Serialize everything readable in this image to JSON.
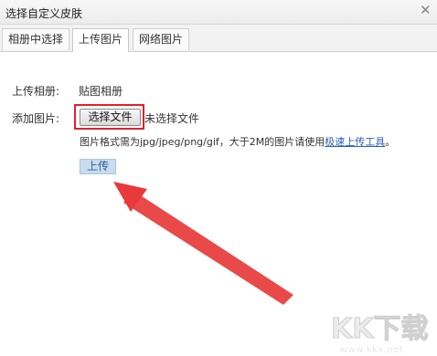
{
  "window": {
    "title": "选择自定义皮肤"
  },
  "tabs": [
    {
      "label": "相册中选择"
    },
    {
      "label": "上传图片"
    },
    {
      "label": "网络图片"
    }
  ],
  "form": {
    "album_label": "上传相册:",
    "album_value": "贴图相册",
    "add_label": "添加图片:",
    "choose_file_button": "选择文件",
    "no_file_text": "未选择文件",
    "hint_text": "图片格式需为jpg/jpeg/png/gif，大于2M的图片请使用",
    "hint_link": "极速上传工具",
    "hint_end": "。",
    "upload_button": "上传"
  },
  "watermark": {
    "logo": "KK下载",
    "url": "www.kkx.net"
  },
  "colors": {
    "highlight": "#e0222b",
    "link": "#2b62b8",
    "upload_button_bg": "#c9dbee"
  }
}
